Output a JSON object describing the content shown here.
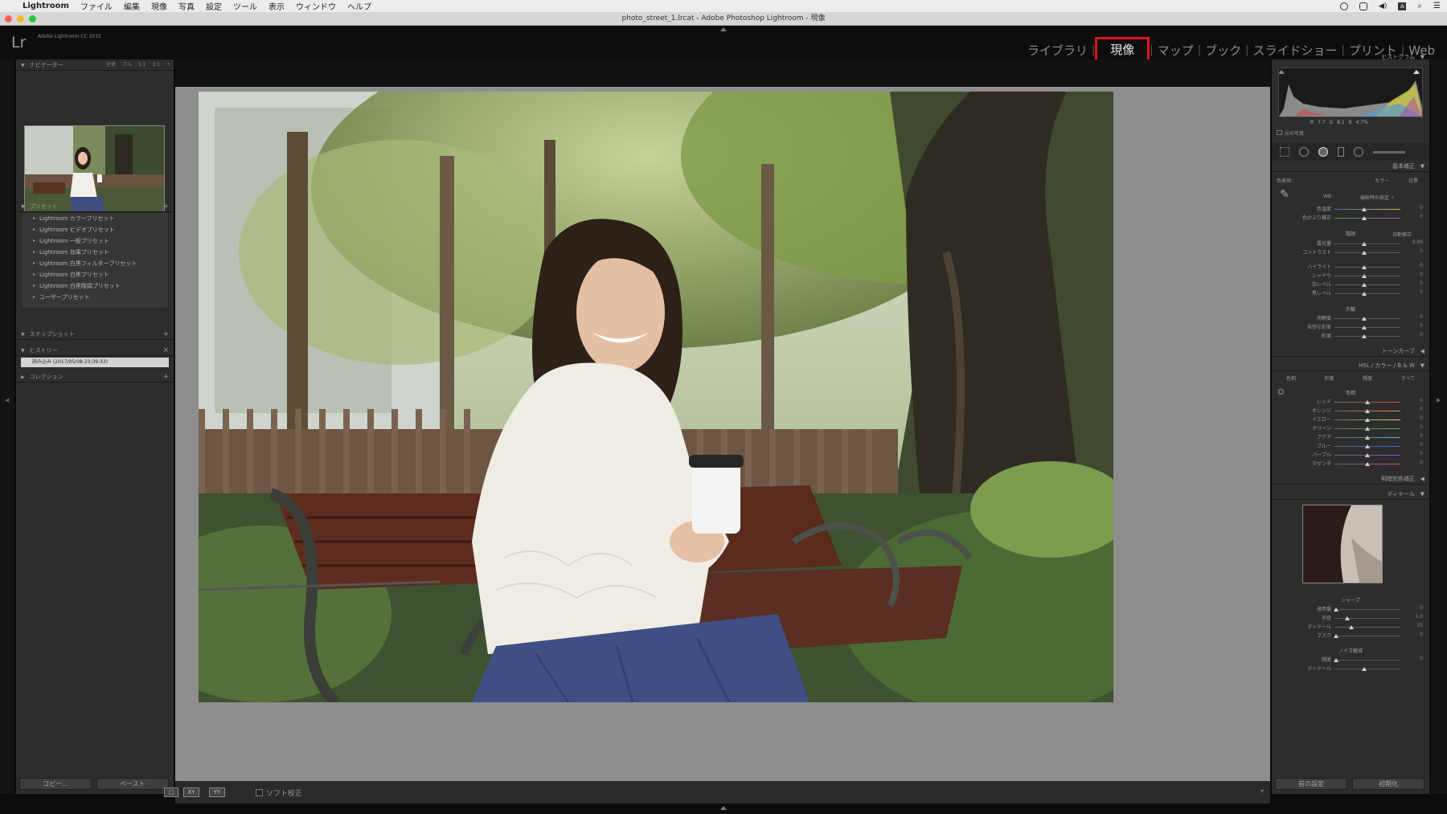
{
  "mac_menubar": {
    "app_name": "Lightroom",
    "menus": [
      "ファイル",
      "編集",
      "現像",
      "写真",
      "設定",
      "ツール",
      "表示",
      "ウィンドウ",
      "ヘルプ"
    ],
    "status_icons": [
      "record-icon",
      "creative-cloud-icon",
      "volume-icon",
      "input-a-icon",
      "search-icon",
      "list-icon"
    ],
    "input_letter": "A"
  },
  "window": {
    "title": "photo_street_1.lrcat - Adobe Photoshop Lightroom - 現像"
  },
  "header": {
    "logo": "Lr",
    "version": "Adobe Lightroom CC 2015",
    "modules": [
      {
        "label": "ライブラリ",
        "active": false
      },
      {
        "label": "現像",
        "active": true
      },
      {
        "label": "マップ",
        "active": false
      },
      {
        "label": "ブック",
        "active": false
      },
      {
        "label": "スライドショー",
        "active": false
      },
      {
        "label": "プリント",
        "active": false
      },
      {
        "label": "Web",
        "active": false
      }
    ],
    "highlight_color": "#e0151b"
  },
  "left_panel": {
    "navigator": {
      "label": "ナビゲーター",
      "zoom_options": "全体 フル 1:1 3:1 ÷"
    },
    "presets": {
      "label": "プリセット",
      "items": [
        "Lightroom カラープリセット",
        "Lightroom ビデオプリセット",
        "Lightroom 一般プリセット",
        "Lightroom 効果プリセット",
        "Lightroom 白黒フィルタープリセット",
        "Lightroom 白黒プリセット",
        "Lightroom 白黒階調プリセット",
        "ユーザープリセット"
      ]
    },
    "snapshots": {
      "label": "スナップショット"
    },
    "history": {
      "label": "ヒストリー",
      "items": [
        "読み込み (2017/05/08 23:39:33)"
      ]
    },
    "collections": {
      "label": "コレクション"
    },
    "copy_button": "コピー...",
    "paste_button": "ペースト"
  },
  "toolbar": {
    "view_loupe": "□",
    "view_compare": "XY",
    "view_grid": "YY",
    "soft_proof_label": "ソフト校正"
  },
  "right_panel": {
    "histogram": {
      "label": "ヒストグラム",
      "rgb": "R 7.7 G 8.1 B 4.7%",
      "original_photo": "元の写真"
    },
    "basic": {
      "label": "基本補正",
      "treatment_label": "色表現 :",
      "treatment_options": [
        "カラー",
        "白黒"
      ],
      "wb_label": "WB :",
      "wb_value": "撮影時の設定 ÷",
      "wb_sliders": [
        {
          "label": "色温度",
          "value": "0",
          "pos": 0.45
        },
        {
          "label": "色かぶり補正",
          "value": "0",
          "pos": 0.45
        }
      ],
      "tone_label": "階調",
      "auto_label": "自動補正",
      "tone_sliders": [
        {
          "label": "露光量",
          "value": "0.00",
          "pos": 0.45
        },
        {
          "label": "コントラスト",
          "value": "0",
          "pos": 0.45
        }
      ],
      "tone_sliders2": [
        {
          "label": "ハイライト",
          "value": "0",
          "pos": 0.45
        },
        {
          "label": "シャドウ",
          "value": "0",
          "pos": 0.45
        },
        {
          "label": "白レベル",
          "value": "0",
          "pos": 0.45
        },
        {
          "label": "黒レベル",
          "value": "0",
          "pos": 0.45
        }
      ],
      "presence_label": "外観",
      "presence_sliders": [
        {
          "label": "明瞭度",
          "value": "0",
          "pos": 0.45
        },
        {
          "label": "自然な彩度",
          "value": "0",
          "pos": 0.45
        },
        {
          "label": "彩度",
          "value": "0",
          "pos": 0.45
        }
      ]
    },
    "tone_curve": {
      "label": "トーンカーブ"
    },
    "hsl": {
      "label": "HSL / カラー / B & W",
      "tabs": [
        "色相",
        "彩度",
        "輝度",
        "すべて"
      ],
      "sub_label": "色相",
      "sliders": [
        {
          "label": "レッド",
          "value": "0",
          "color": "#d44"
        },
        {
          "label": "オレンジ",
          "value": "0",
          "color": "#e93"
        },
        {
          "label": "イエロー",
          "value": "0",
          "color": "#dd4"
        },
        {
          "label": "グリーン",
          "value": "0",
          "color": "#4b4"
        },
        {
          "label": "アクア",
          "value": "0",
          "color": "#4bb"
        },
        {
          "label": "ブルー",
          "value": "0",
          "color": "#46d"
        },
        {
          "label": "パープル",
          "value": "0",
          "color": "#94d"
        },
        {
          "label": "マゼンタ",
          "value": "0",
          "color": "#d4b"
        }
      ]
    },
    "split_toning": {
      "label": "明暗別色補正"
    },
    "detail": {
      "label": "ディテール",
      "sharpen_label": "シャープ",
      "sharpen_sliders": [
        {
          "label": "適用量",
          "value": "0",
          "pos": 0.02
        },
        {
          "label": "半径",
          "value": "1.0",
          "pos": 0.2
        },
        {
          "label": "ディテール",
          "value": "25",
          "pos": 0.25
        },
        {
          "label": "マスク",
          "value": "0",
          "pos": 0.02
        }
      ],
      "noise_label": "ノイズ軽減",
      "noise_sliders": [
        {
          "label": "輝度",
          "value": "0",
          "pos": 0.02
        },
        {
          "label": "ディテール",
          "value": "",
          "pos": 0.45
        }
      ]
    },
    "previous_button": "前の設定",
    "reset_button": "初期化"
  }
}
